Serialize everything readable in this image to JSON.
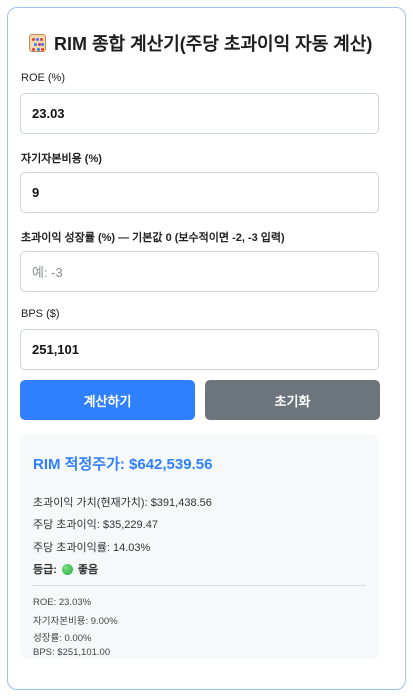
{
  "header": {
    "icon": "abacus-icon",
    "title": "RIM 종합 계산기(주당 초과이익 자동 계산)"
  },
  "form": {
    "roe": {
      "label": "ROE (%)",
      "value": "23.03"
    },
    "coe": {
      "label": "자기자본비용 (%)",
      "value": "9"
    },
    "growth": {
      "label": "초과이익 성장률 (%) — 기본값 0 (보수적이면 -2, -3 입력)",
      "placeholder": "예: -3",
      "value": ""
    },
    "bps": {
      "label": "BPS ($)",
      "value": "251,101"
    }
  },
  "buttons": {
    "calc": "계산하기",
    "reset": "초기화"
  },
  "result": {
    "title": "RIM 적정주가: $642,539.56",
    "excess_value": "초과이익 가치(현재가치): $391,438.56",
    "eps_excess": "주당 초과이익: $35,229.47",
    "excess_rate": "주당 초과이익률: 14.03%",
    "grade_label": "등급:",
    "grade_value": "좋음",
    "summary": [
      "ROE: 23.03%",
      "자기자본비용: 9.00%",
      "성장률: 0.00%",
      "BPS: $251,101.00"
    ]
  },
  "colors": {
    "accent": "#2f80ff",
    "reset": "#6c757d",
    "grade_good": "#22a84a"
  }
}
